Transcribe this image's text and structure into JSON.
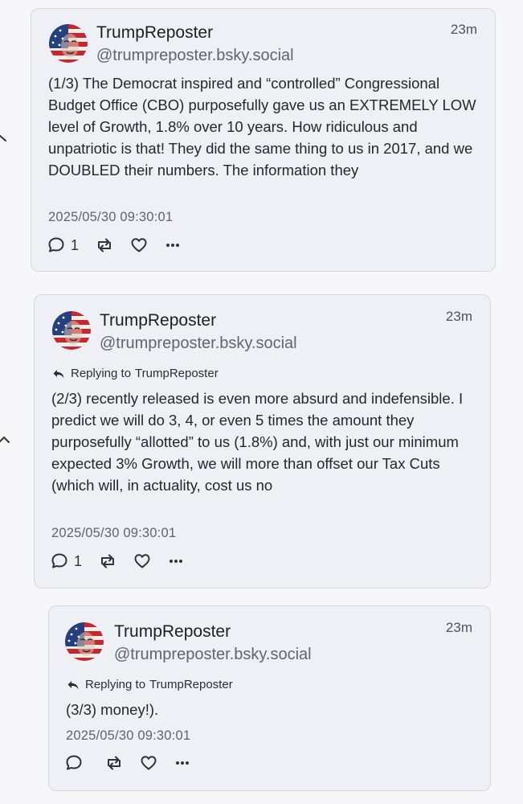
{
  "thread": [
    {
      "display_name": "TrumpReposter",
      "handle": "@trumpreposter.bsky.social",
      "time_ago": "23m",
      "reply_prefix": "",
      "reply_to": "",
      "text": "(1/3) The Democrat inspired and “controlled” Congressional Budget Office (CBO) purposefully gave us an EXTREMELY LOW level of Growth, 1.8% over 10 years. How ridiculous and unpatriotic is that! They did the same thing to us in 2017, and we DOUBLED their numbers. The information they",
      "timestamp": "2025/05/30 09:30:01",
      "reply_count": "1"
    },
    {
      "display_name": "TrumpReposter",
      "handle": "@trumpreposter.bsky.social",
      "time_ago": "23m",
      "reply_prefix": "Replying to",
      "reply_to": "TrumpReposter",
      "text": "(2/3) recently released is even more absurd and indefensible. I predict we will do 3, 4, or even 5 times the amount they purposefully “allotted” to us (1.8%) and, with just our minimum expected 3% Growth, we will more than offset our Tax Cuts (which will, in actuality, cost us no",
      "timestamp": "2025/05/30 09:30:01",
      "reply_count": "1"
    },
    {
      "display_name": "TrumpReposter",
      "handle": "@trumpreposter.bsky.social",
      "time_ago": "23m",
      "reply_prefix": "Replying to",
      "reply_to": "TrumpReposter",
      "text": "(3/3) money!).",
      "timestamp": "2025/05/30 09:30:01",
      "reply_count": ""
    }
  ],
  "icons": {
    "reply": "speech-bubble-icon",
    "repost": "repost-arrows-icon",
    "like": "heart-outline-icon",
    "more": "ellipsis-icon",
    "reply_indicator": "reply-arrow-icon",
    "collapse": "chevron-icon"
  },
  "colors": {
    "card_background": "#eef0f5",
    "card_border": "#d5d8df",
    "page_background": "#f7f7f9",
    "text_primary": "#1d1f24",
    "text_secondary": "#60656f"
  }
}
